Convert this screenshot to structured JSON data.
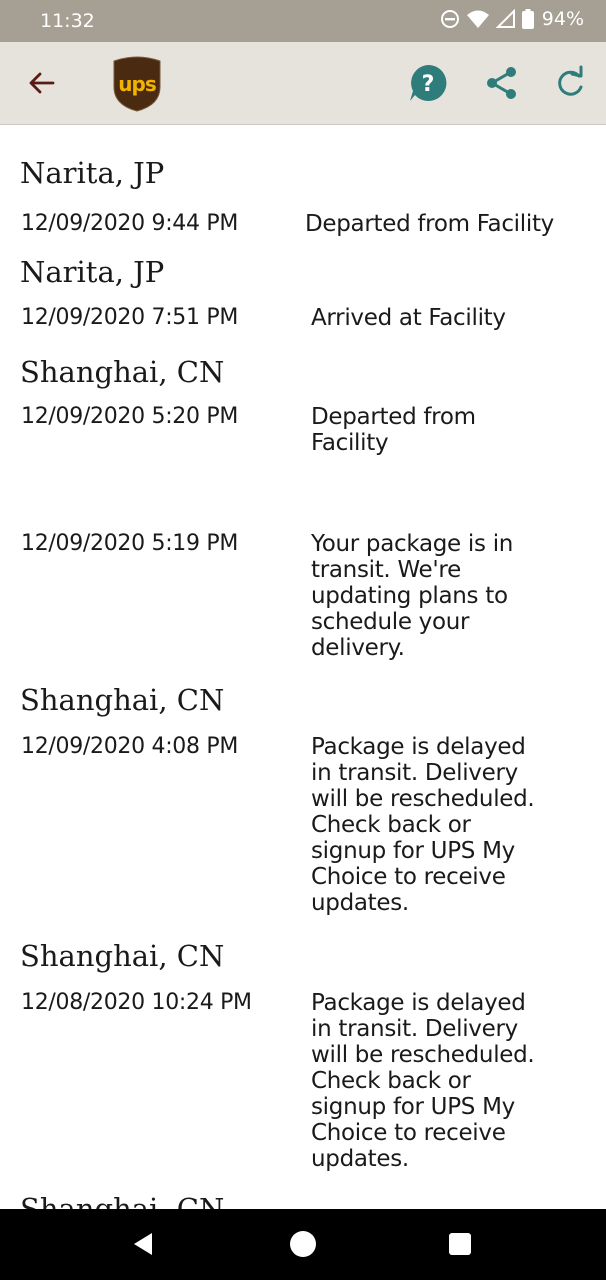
{
  "status_bar": {
    "time": "11:32",
    "battery": "94%",
    "icons": [
      "do-not-disturb-icon",
      "wifi-icon",
      "signal-icon",
      "battery-icon"
    ]
  },
  "app_bar": {
    "logo_text": "ups",
    "icons": [
      "back-arrow-icon",
      "ups-logo",
      "help-icon",
      "share-icon",
      "refresh-icon"
    ],
    "help_symbol": "?",
    "colors": {
      "accent": "#2e7d7a",
      "brand_brown": "#4b2a12",
      "brand_gold": "#f2b300"
    }
  },
  "events": [
    {
      "location": "Narita, JP",
      "datetime": "12/09/2020 9:44 PM",
      "description": "Departed from Facility"
    },
    {
      "location": "Narita, JP",
      "datetime": "12/09/2020  7:51 PM",
      "description": "Arrived at Facility"
    },
    {
      "location": "Shanghai, CN",
      "datetime": "12/09/2020  5:20 PM",
      "description": "Departed from Facility"
    },
    {
      "location": "",
      "datetime": "12/09/2020  5:19 PM",
      "description": "Your package is in transit. We're updating plans to schedule your delivery."
    },
    {
      "location": "Shanghai, CN",
      "datetime": "12/09/2020  4:08 PM",
      "description": "Package is delayed in transit. Delivery will be rescheduled. Check back or signup for UPS My Choice to receive updates."
    },
    {
      "location": "Shanghai, CN",
      "datetime": "12/08/2020  10:24 PM",
      "description": "Package is delayed in transit. Delivery will be rescheduled. Check back or signup for UPS My Choice to receive updates."
    },
    {
      "location": "Shanghai, CN",
      "datetime": "",
      "description": ""
    }
  ],
  "nav_bar": {
    "icons": [
      "nav-back-icon",
      "nav-home-icon",
      "nav-recents-icon"
    ]
  }
}
